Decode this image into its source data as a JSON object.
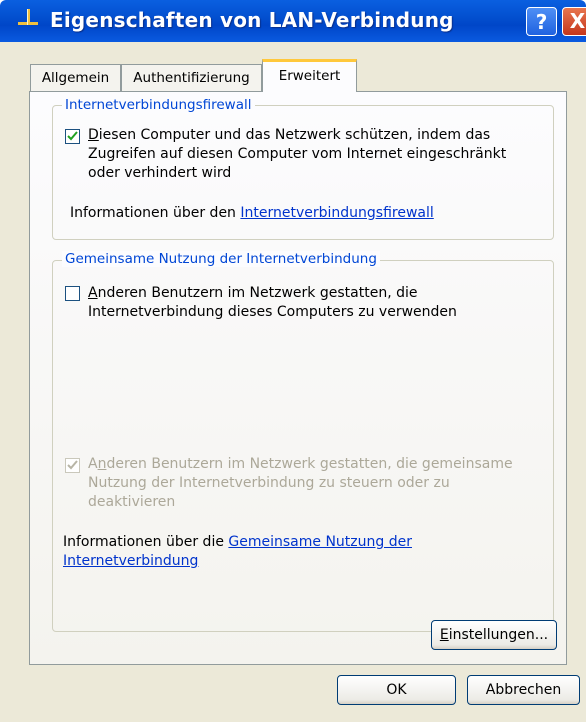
{
  "window": {
    "title": "Eigenschaften von LAN-Verbindung",
    "help_label": "?",
    "close_label": "X"
  },
  "tabs": [
    {
      "label": "Allgemein",
      "active": false
    },
    {
      "label": "Authentifizierung",
      "active": false
    },
    {
      "label": "Erweitert",
      "active": true
    }
  ],
  "firewall": {
    "group_title": "Internetverbindungsfirewall",
    "checkbox_checked": true,
    "checkbox_label_first": "D",
    "checkbox_label_rest_line1": "iesen Computer und das Netzwerk schützen, indem das",
    "checkbox_label_line2": "Zugreifen auf diesen Computer vom Internet eingeschränkt",
    "checkbox_label_line3": "oder verhindert wird",
    "info_prefix": "Informationen über den ",
    "info_link": "Internetverbindungsfirewall"
  },
  "sharing": {
    "group_title": "Gemeinsame Nutzung der Internetverbindung",
    "allow_connect_checked": false,
    "allow_connect_first": "A",
    "allow_connect_rest_line1": "nderen Benutzern im Netzwerk gestatten, die",
    "allow_connect_line2": "Internetverbindung dieses Computers zu verwenden",
    "allow_control_checked": true,
    "allow_control_disabled": true,
    "allow_control_line1_pre": "A",
    "allow_control_line1_u": "n",
    "allow_control_line1_rest": "deren Benutzern im Netzwerk gestatten, die gemeinsame",
    "allow_control_line2": "Nutzung der Internetverbindung zu steuern oder zu",
    "allow_control_line3": "deaktivieren",
    "info_prefix": "Informationen über die ",
    "info_link_line1": "Gemeinsame Nutzung der",
    "info_link_line2": "Internetverbindung"
  },
  "buttons": {
    "settings_first": "E",
    "settings_rest": "instellungen...",
    "ok": "OK",
    "cancel": "Abbrechen"
  },
  "colors": {
    "title_bar": "#0054e3",
    "group_title": "#0046d5",
    "link": "#0033cc",
    "active_tab_accent": "#ffc83c",
    "dialog_background": "#ece9d8"
  }
}
